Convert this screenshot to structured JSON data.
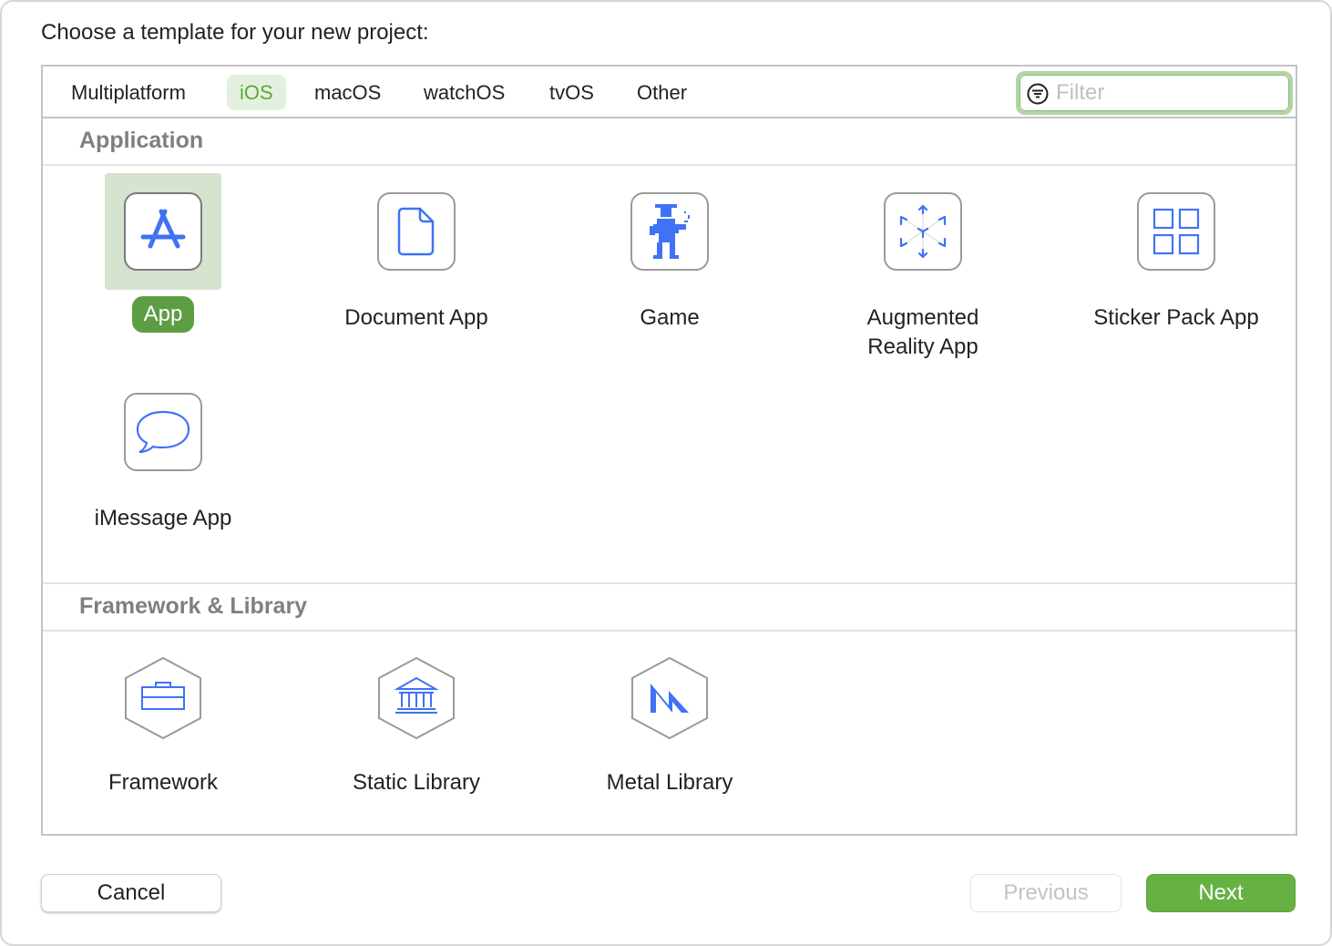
{
  "title": "Choose a template for your new project:",
  "tabs": [
    "Multiplatform",
    "iOS",
    "macOS",
    "watchOS",
    "tvOS",
    "Other"
  ],
  "selected_tab": "iOS",
  "filter": {
    "placeholder": "Filter",
    "value": ""
  },
  "sections": [
    {
      "title": "Application",
      "items": [
        "App",
        "Document App",
        "Game",
        "Augmented Reality App",
        "Sticker Pack App",
        "iMessage App"
      ]
    },
    {
      "title": "Framework & Library",
      "items": [
        "Framework",
        "Static Library",
        "Metal Library"
      ]
    }
  ],
  "selected_item": "App",
  "ar_label": [
    "Augmented",
    "Reality App"
  ],
  "buttons": {
    "cancel": "Cancel",
    "previous": "Previous",
    "next": "Next"
  },
  "colors": {
    "accent": "#66b143",
    "icon_blue": "#3f72f5"
  }
}
